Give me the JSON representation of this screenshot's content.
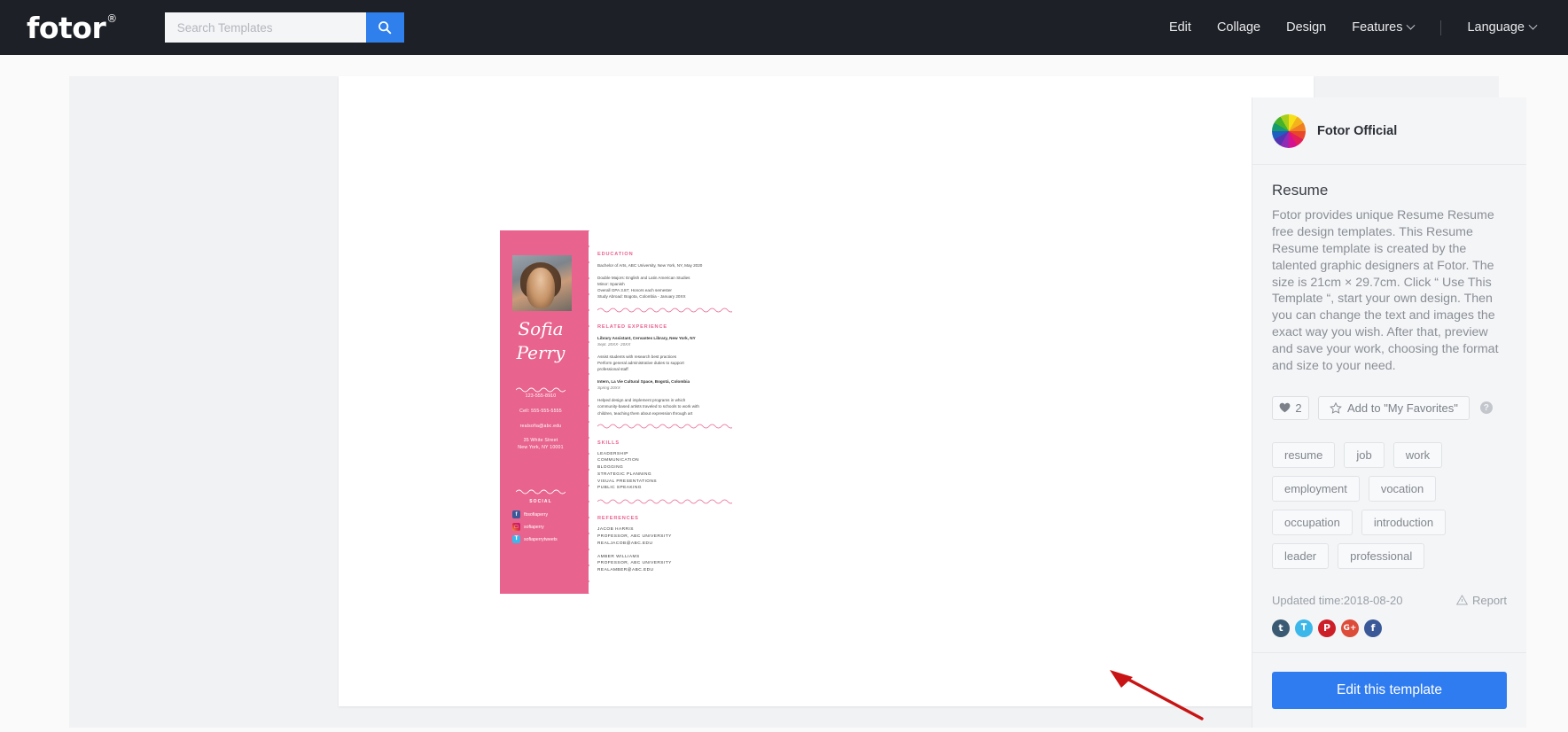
{
  "brand": {
    "logo_text": "fotor",
    "registered_mark": "®"
  },
  "search": {
    "placeholder": "Search Templates",
    "value": "",
    "icon": "search-icon"
  },
  "nav": {
    "links": [
      {
        "label": "Edit",
        "has_caret": false
      },
      {
        "label": "Collage",
        "has_caret": false
      },
      {
        "label": "Design",
        "has_caret": false
      },
      {
        "label": "Features",
        "has_caret": true
      }
    ],
    "language": {
      "label": "Language",
      "has_caret": true
    }
  },
  "sidebar": {
    "author": {
      "name": "Fotor Official",
      "avatar": "color-wheel-avatar"
    },
    "title": "Resume",
    "description": "Fotor provides unique Resume Resume free design templates. This Resume Resume template is created by the talented graphic designers at Fotor. The size is 21cm × 29.7cm. Click “ Use This Template “, start your own design. Then you can change the text and images the exact way you wish. After that, preview and save your work, choosing the format and size to your need.",
    "actions": {
      "like_count": "2",
      "like_icon": "heart-icon",
      "favorite_label": "Add to \"My Favorites\"",
      "favorite_icon": "star-icon",
      "help_icon": "question-mark-icon",
      "help_glyph": "?"
    },
    "tags": [
      "resume",
      "job",
      "work",
      "employment",
      "vocation",
      "occupation",
      "introduction",
      "leader",
      "professional"
    ],
    "updated_time": "Updated time:2018-08-20",
    "report_label": "Report",
    "report_icon": "warning-triangle-icon",
    "share": [
      {
        "name": "tumblr",
        "glyph": "t",
        "color": "#3a5972"
      },
      {
        "name": "twitter",
        "glyph": "𝐓",
        "color": "#3bb7ea"
      },
      {
        "name": "pinterest",
        "glyph": "P",
        "color": "#cd1f28"
      },
      {
        "name": "google-plus",
        "glyph": "G+",
        "color": "#dd4b39"
      },
      {
        "name": "facebook",
        "glyph": "f",
        "color": "#3b5998"
      }
    ],
    "cta_label": "Edit this template"
  },
  "resume": {
    "name_line1": "Sofia",
    "name_line2": "Perry",
    "contact": [
      "123-555-8910",
      "Cell: 555-555-5555",
      "realsofia@abc.edu",
      "35 White Street\nNew York, NY 10001"
    ],
    "contact_phone": "123-555-8910",
    "contact_cell": "Cell: 555-555-5555",
    "contact_email": "realsofia@abc.edu",
    "contact_addr1": "35 White Street",
    "contact_addr2": "New York, NY 10001",
    "social_heading": "SOCIAL",
    "social": [
      {
        "network": "facebook",
        "glyph": "f",
        "handle": "fbsofiaperry",
        "color": "#3b5998"
      },
      {
        "network": "instagram",
        "glyph": "□",
        "handle": "sofiaperry",
        "color": "#8a3ab9"
      },
      {
        "network": "twitter",
        "glyph": "𝐓",
        "handle": "sofiaperrytweets",
        "color": "#3bb7ea"
      }
    ],
    "education": {
      "heading": "EDUCATION",
      "line1": "Bachelor of Arts, ABC University, New York, NY, May 2020",
      "details": [
        "Double Majors: English and Latin American Studies",
        "Minor: Spanish",
        "Overall GPA 3.87; Honors each semester",
        "Study Abroad: Bogota, Colombia - January 20XX"
      ]
    },
    "experience": {
      "heading": "RELATED EXPERIENCE",
      "jobs": [
        {
          "title": "Library Assistant, Cervantes Library, New York, NY",
          "dates": "Sept. 20XX- 20XX",
          "bullets": [
            "Assist students with research best practices",
            "Perform general administrative duties to support",
            "professional staff"
          ]
        },
        {
          "title": "Intern, La Vie Cultural Space, Bogotá, Colombia",
          "dates": "Spring 20XX",
          "bullets": [
            "Helped design and implement programs in which",
            "community-based artists traveled to schools to work with",
            "children, teaching them about expression through art"
          ]
        }
      ]
    },
    "skills": {
      "heading": "SKILLS",
      "items": [
        "LEADERSHIP",
        "COMMUNICATION",
        "BLOGGING",
        "STRATEGIC PLANNING",
        "VISUAL PRESENTATIONS",
        "PUBLIC SPEAKING"
      ]
    },
    "references": {
      "heading": "REFERENCES",
      "people": [
        {
          "name": "JACOB HARRIS",
          "role": "PROFESSOR, ABC UNIVERSITY",
          "email": "REALJACOB@ABC.EDU"
        },
        {
          "name": "AMBER WILLIAMS",
          "role": "PROFESSOR, ABC UNIVERSITY",
          "email": "REALAMBER@ABC.EDU"
        }
      ]
    }
  },
  "colors": {
    "nav_bg": "#1d2027",
    "accent_blue": "#2f7cf0",
    "resume_pink": "#e8638e",
    "annotation_red": "#c81414"
  }
}
